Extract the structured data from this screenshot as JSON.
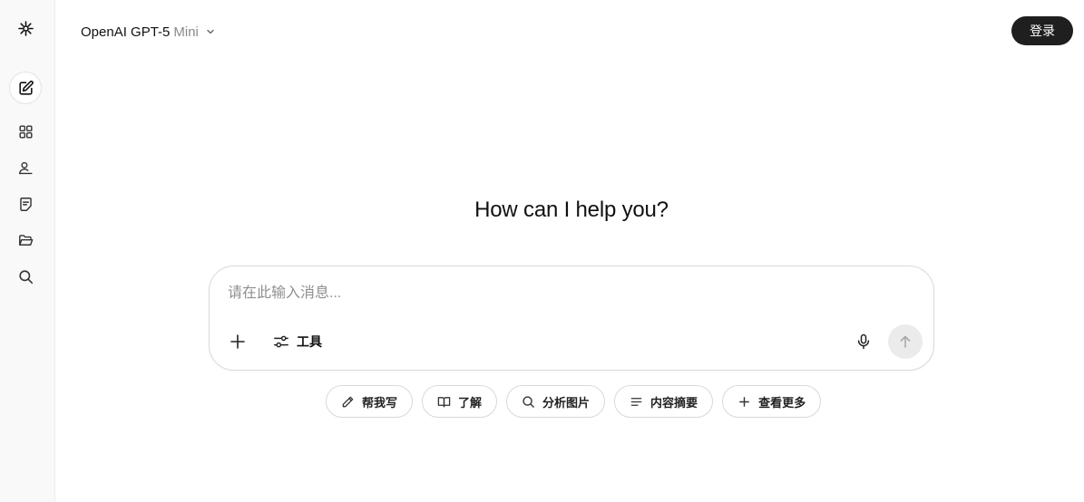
{
  "sidebar": {
    "items": [
      {
        "icon": "logo-sparkle-icon"
      },
      {
        "icon": "new-chat-icon"
      },
      {
        "icon": "apps-grid-icon"
      },
      {
        "icon": "user-profile-icon"
      },
      {
        "icon": "notes-icon"
      },
      {
        "icon": "folder-open-icon"
      },
      {
        "icon": "search-icon"
      }
    ]
  },
  "header": {
    "model_name": "OpenAI GPT-5",
    "model_variant": "Mini",
    "login_label": "登录"
  },
  "main": {
    "greeting": "How can I help you?"
  },
  "composer": {
    "placeholder": "请在此输入消息...",
    "value": "",
    "tools_label": "工具"
  },
  "suggestions": [
    {
      "icon": "pencil-icon",
      "label": "帮我写"
    },
    {
      "icon": "book-open-icon",
      "label": "了解"
    },
    {
      "icon": "search-icon",
      "label": "分析图片"
    },
    {
      "icon": "list-icon",
      "label": "内容摘要"
    },
    {
      "icon": "plus-icon",
      "label": "查看更多"
    }
  ],
  "colors": {
    "sidebar_bg": "#f9f9f9",
    "login_button_bg": "#1f1f1f",
    "send_button_bg": "#ebebeb",
    "border": "#d9d9d9",
    "placeholder_text": "#8f8f8f",
    "model_variant_text": "#8a8a8a"
  }
}
